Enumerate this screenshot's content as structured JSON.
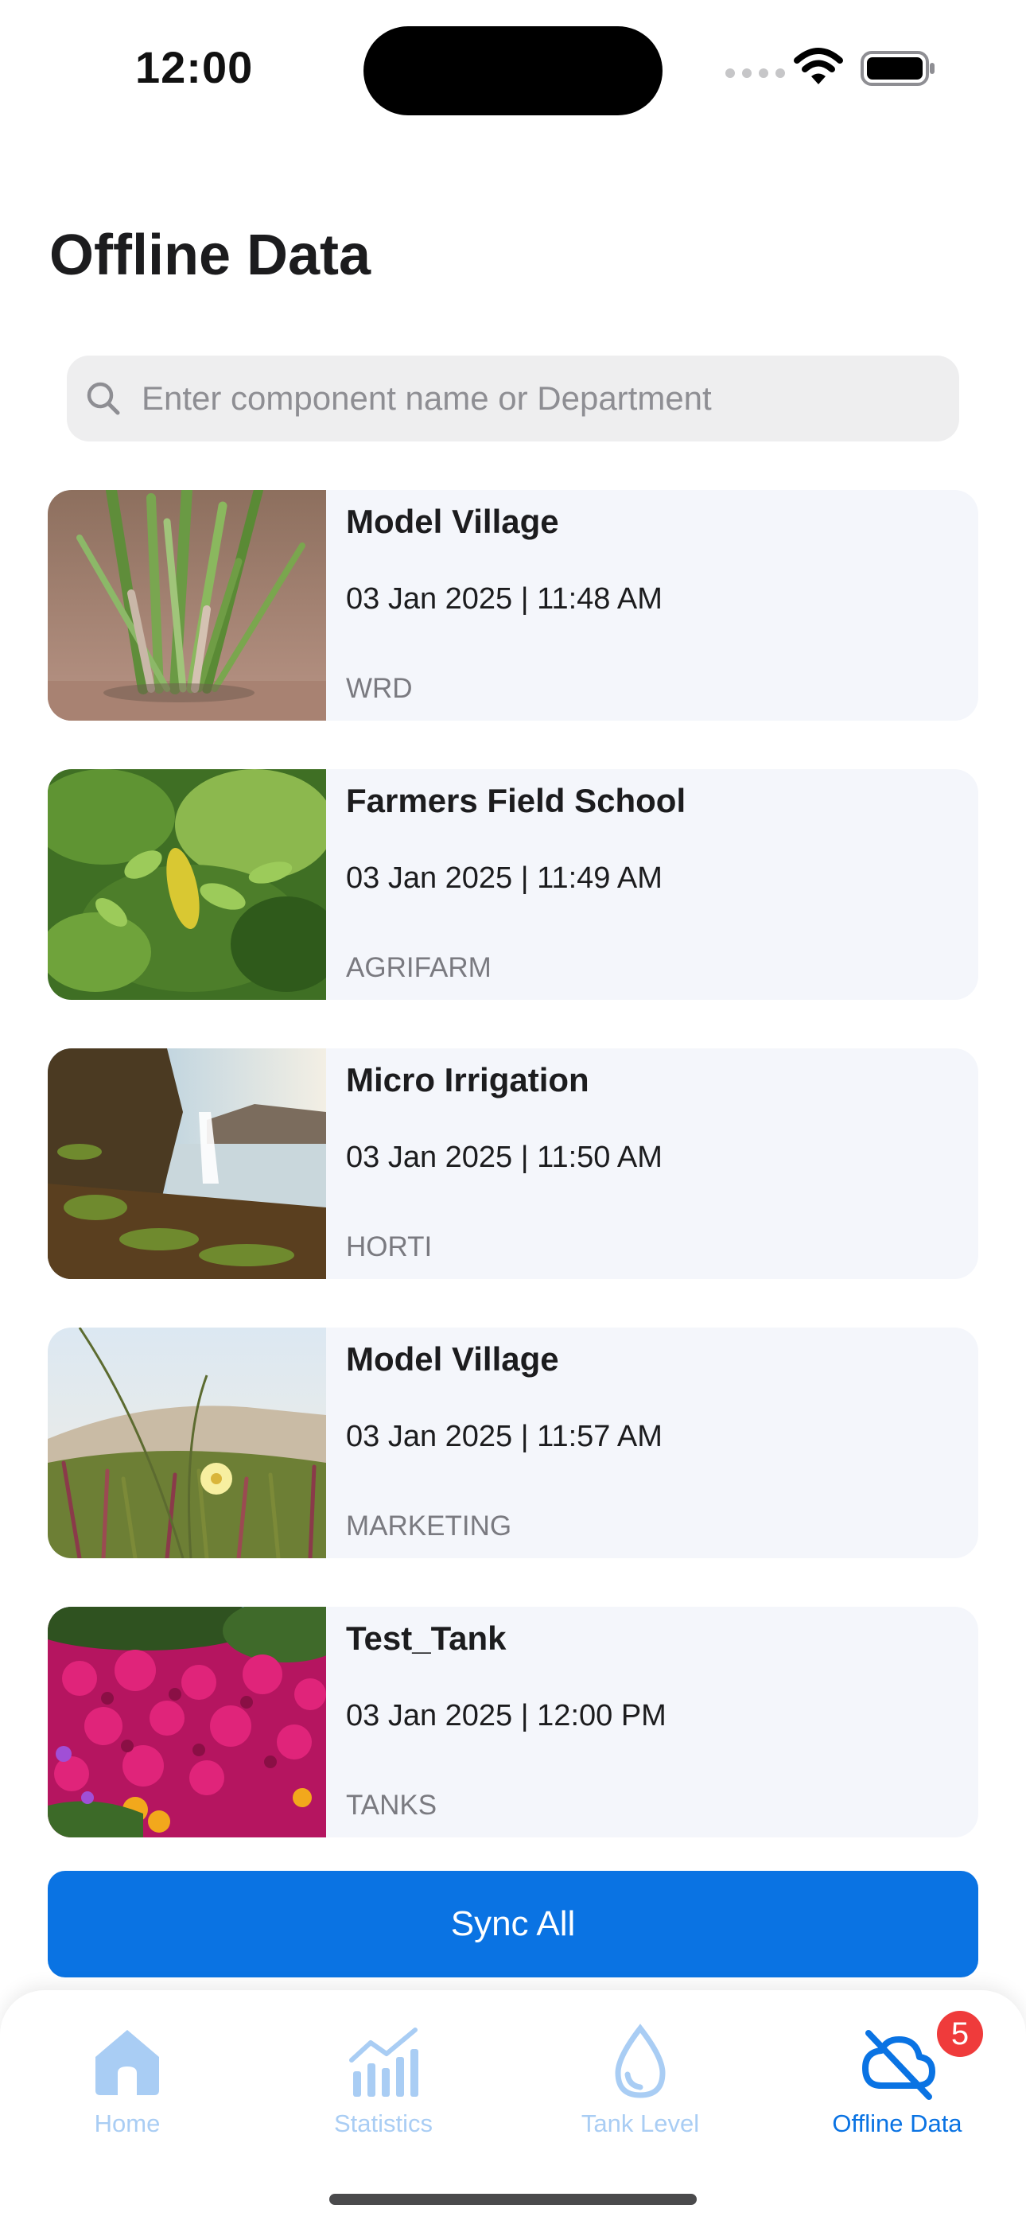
{
  "status_bar": {
    "time": "12:00"
  },
  "page": {
    "title": "Offline Data"
  },
  "search": {
    "placeholder": "Enter component name or Department",
    "value": ""
  },
  "items": [
    {
      "title": "Model Village",
      "datetime": "03 Jan 2025 | 11:48 AM",
      "department": "WRD"
    },
    {
      "title": "Farmers Field School",
      "datetime": "03 Jan 2025 | 11:49 AM",
      "department": "AGRIFARM"
    },
    {
      "title": "Micro Irrigation",
      "datetime": "03 Jan 2025 | 11:50 AM",
      "department": "HORTI"
    },
    {
      "title": "Model Village",
      "datetime": "03 Jan 2025 | 11:57 AM",
      "department": "MARKETING"
    },
    {
      "title": "Test_Tank",
      "datetime": "03 Jan 2025 | 12:00 PM",
      "department": "TANKS"
    }
  ],
  "sync_button": {
    "label": "Sync All"
  },
  "tabs": [
    {
      "label": "Home",
      "icon": "home-icon",
      "active": false
    },
    {
      "label": "Statistics",
      "icon": "chart-icon",
      "active": false
    },
    {
      "label": "Tank Level",
      "icon": "water-drop-icon",
      "active": false
    },
    {
      "label": "Offline Data",
      "icon": "cloud-off-icon",
      "active": true,
      "badge": "5"
    }
  ],
  "colors": {
    "accent": "#0a73e3",
    "tab_inactive": "#a9cdf4",
    "card_bg": "#f4f6fb",
    "badge": "#ef3b3b"
  }
}
